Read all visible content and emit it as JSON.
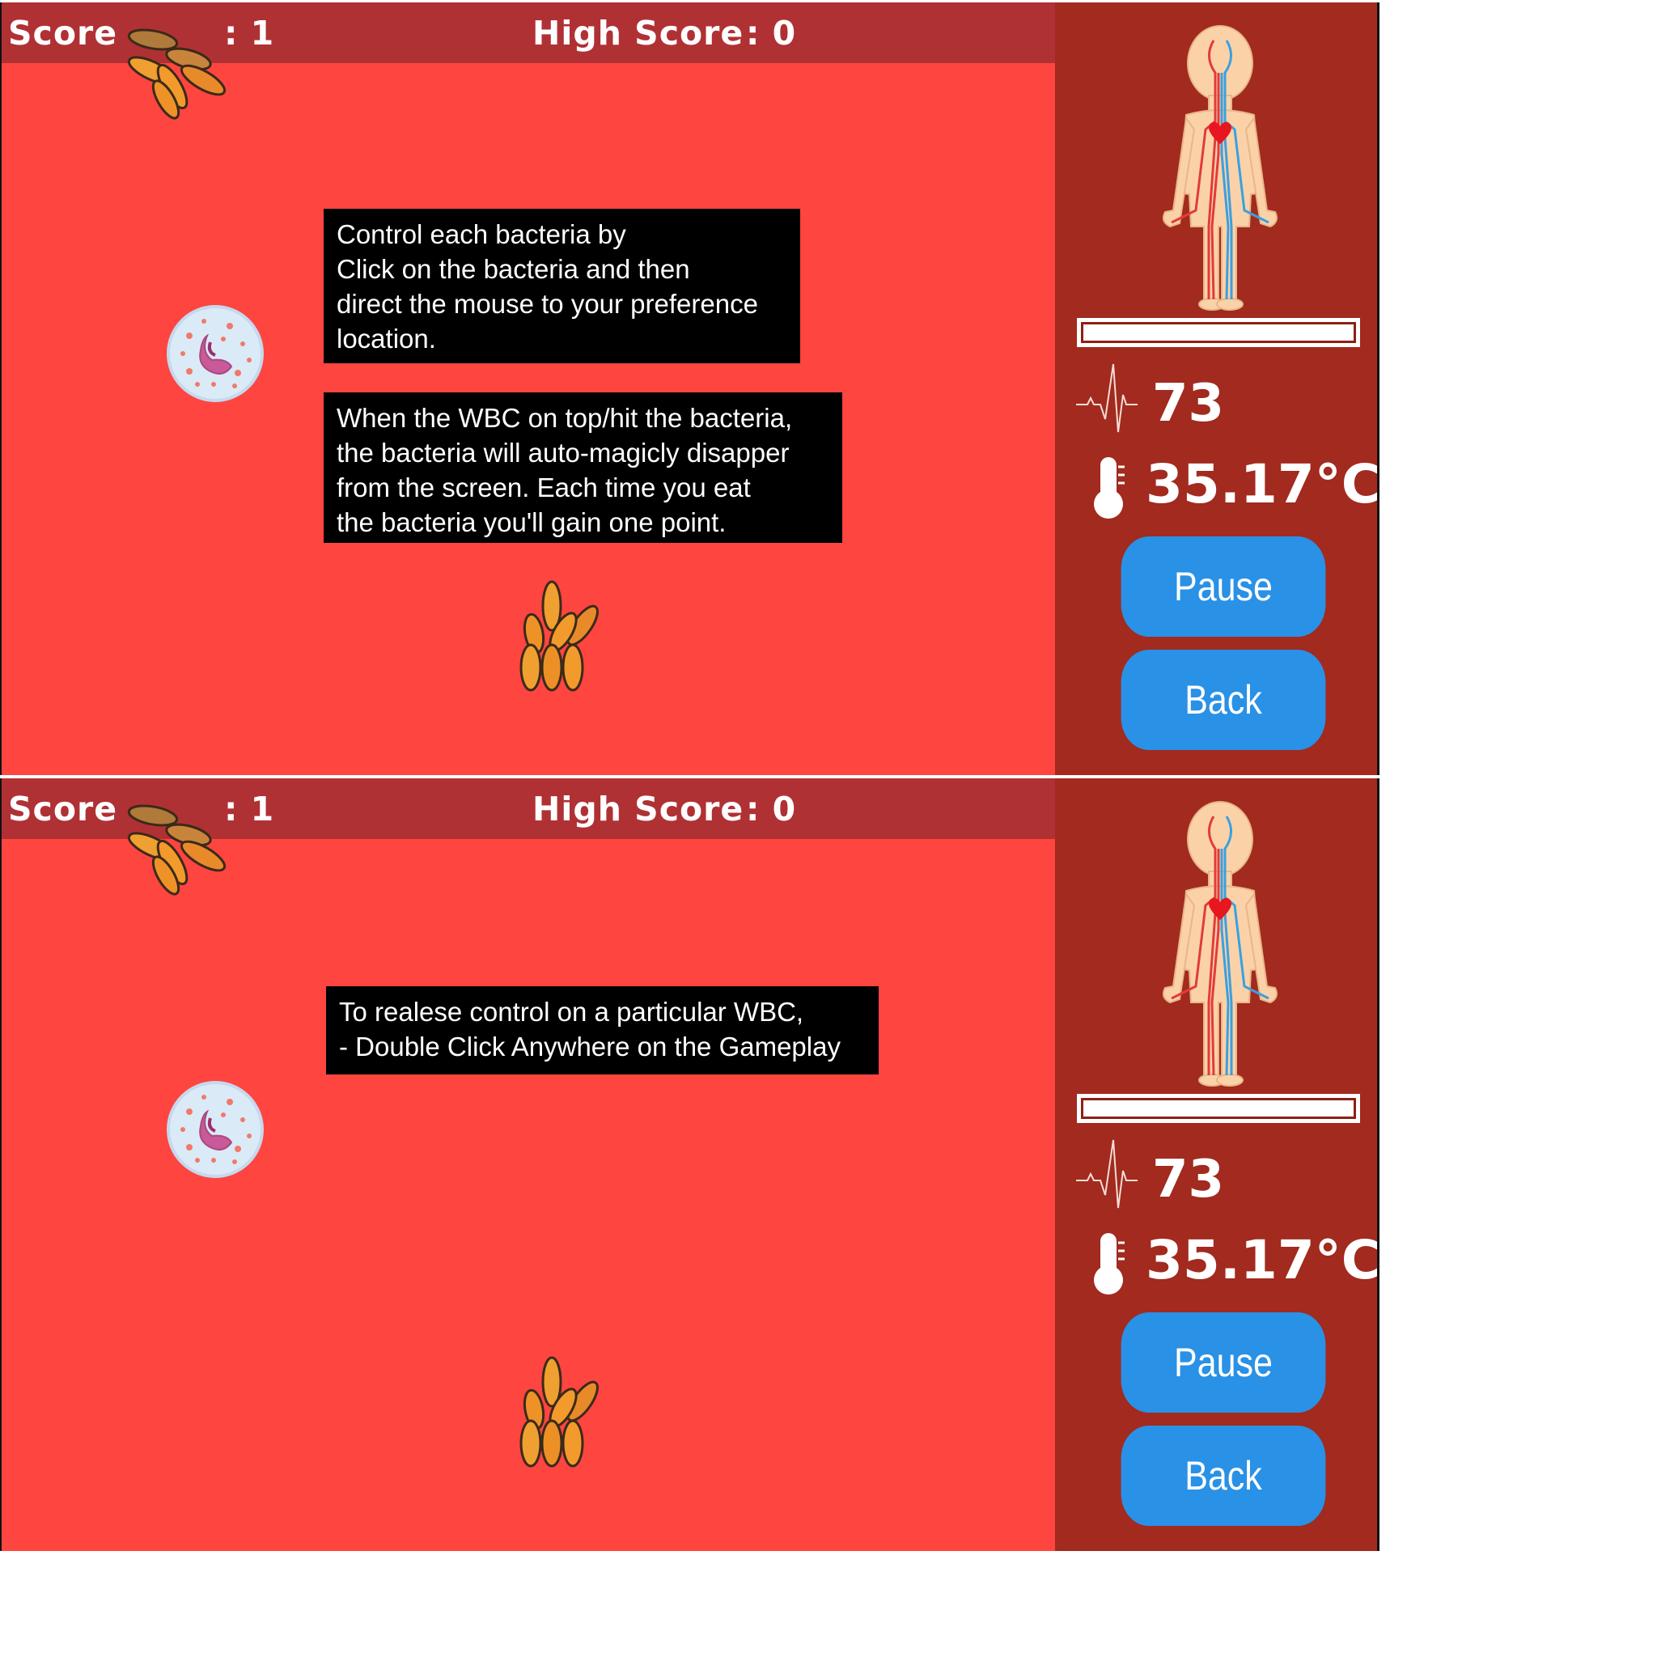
{
  "hud": {
    "score_label": "Score",
    "score_value": ": 1",
    "high_score_label": "High Score",
    "high_score_value": ": 0"
  },
  "screens": [
    {
      "tips": [
        [
          "Control each bacteria by",
          "Click on the bacteria and then",
          "direct the mouse to your preference",
          "location."
        ],
        [
          "When the WBC on top/hit the bacteria,",
          "the bacteria will auto-magicly disapper",
          "from the screen. Each time you eat",
          "the bacteria you'll gain one point."
        ]
      ]
    },
    {
      "tips": [
        [
          "To realese control on a particular WBC,",
          "- Double Click Anywhere on the Gameplay"
        ]
      ]
    }
  ],
  "sidebar": {
    "heart_rate": "73",
    "temperature": "35.17°C",
    "pause_label": "Pause",
    "back_label": "Back"
  },
  "colors": {
    "game_bg": "#fe453f",
    "top_bar": "#b03134",
    "sidebar_bg": "#a22a1e",
    "button": "#2991e6"
  },
  "icons": [
    "bacteria-icon",
    "white-blood-cell-icon",
    "human-body-icon",
    "heartbeat-icon",
    "thermometer-icon"
  ]
}
